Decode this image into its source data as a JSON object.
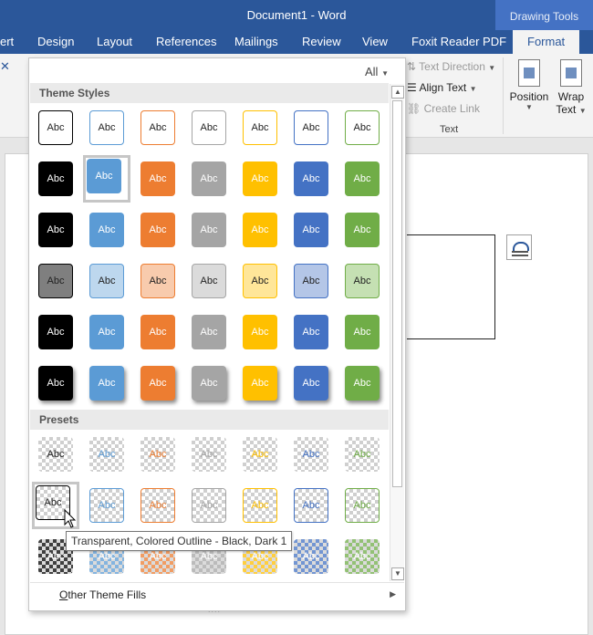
{
  "title_bar": {
    "doc_title": "Document1 - Word",
    "context_group": "Drawing Tools"
  },
  "tabs": [
    {
      "label": "ert"
    },
    {
      "label": "Design"
    },
    {
      "label": "Layout"
    },
    {
      "label": "References"
    },
    {
      "label": "Mailings"
    },
    {
      "label": "Review"
    },
    {
      "label": "View"
    },
    {
      "label": "Foxit Reader PDF"
    },
    {
      "label": "Format"
    }
  ],
  "ribbon": {
    "text_direction": "Text Direction",
    "align_text": "Align Text",
    "create_link": "Create Link",
    "text_group": "Text",
    "position": "Position",
    "wrap_text_1": "Wrap",
    "wrap_text_2": "Text"
  },
  "gallery": {
    "filter": "All",
    "theme_styles_header": "Theme Styles",
    "presets_header": "Presets",
    "cell_label": "Abc",
    "other_fills": "Other Theme Fills",
    "other_fills_access": "O",
    "other_fills_rest": "ther Theme Fills",
    "grip": "....",
    "colors": [
      "#000000",
      "#5b9bd5",
      "#ed7d31",
      "#a5a5a5",
      "#ffc000",
      "#4472c4",
      "#70ad47"
    ],
    "light_colors": [
      "#7f7f7f",
      "#bdd7ee",
      "#f8cbad",
      "#dbdbdb",
      "#ffe699",
      "#b4c6e7",
      "#c5e0b3"
    ],
    "theme_rows": [
      "outline",
      "solid",
      "solid",
      "light",
      "solid",
      "shadow"
    ],
    "preset_rows": [
      "trans",
      "trans-outline",
      "trans-dark"
    ]
  },
  "tooltip": "Transparent, Colored Outline - Black, Dark 1"
}
